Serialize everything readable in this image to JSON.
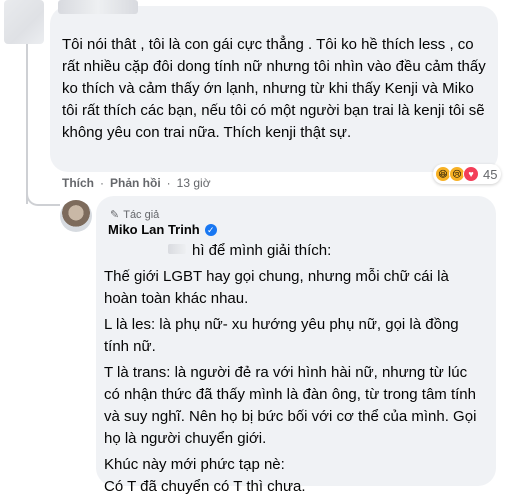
{
  "comment": {
    "text": "Tôi nói thât , tôi là con gái cực thẳng . Tôi ko hề thích less , co rất nhiều cặp đôi dong tính nữ nhưng tôi nhìn vào đều cảm thấy ko thích và cảm thấy ớn lạnh, nhưng từ khi thấy Kenji và Miko tôi rất thích các bạn, nếu tôi có một người bạn trai là kenji tôi sẽ không yêu con trai nữa. Thích kenji thật sự.",
    "like_label": "Thích",
    "reply_label": "Phản hồi",
    "time": "13 giờ",
    "reaction_count": "45",
    "reaction_icons": [
      "haha-icon",
      "sad-icon",
      "love-icon"
    ]
  },
  "reply": {
    "author_tag": "Tác giả",
    "author_name": "Miko Lan Trinh",
    "paragraphs": [
      "hì để mình giải thích:",
      "Thế giới LGBT hay gọi chung, nhưng mỗi chữ cái là hoàn toàn khác nhau.",
      "L là les: là phụ nữ- xu hướng yêu phụ nữ, gọi là đồng tính nữ.",
      "T là trans: là người đẻ ra với hình hài nữ, nhưng từ lúc có nhận thức đã thấy mình là đàn ông, từ trong tâm tính và suy nghĩ. Nên họ bị bức bối với cơ thể của mình. Gọi họ là người chuyển giới.",
      "Khúc này mới phức tạp nè:",
      "Có T đã chuyển có T thì chưa."
    ]
  },
  "colors": {
    "bubble_bg": "#f0f2f5",
    "meta_gray": "#65676b",
    "verified_blue": "#1877f2",
    "love_red": "#f33e58",
    "haha_yellow": "#f7b125"
  }
}
